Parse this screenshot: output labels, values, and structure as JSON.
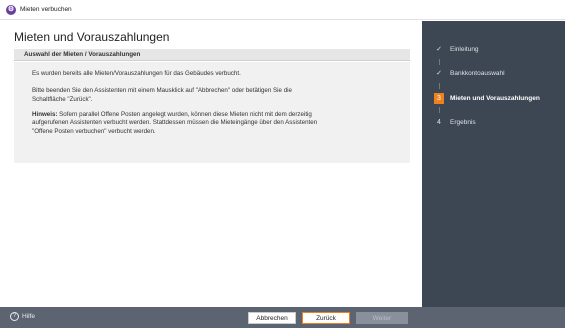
{
  "window": {
    "title": "Mieten verbuchen",
    "icon": "app-logo-icon"
  },
  "page": {
    "title": "Mieten und Vorauszahlungen",
    "section_title": "Auswahl der Mieten / Vorauszahlungen",
    "para1": "Es wurden bereits alle Mieten/Vorauszahlungen für das Gebäudes verbucht.",
    "para2_line1": "Bitte beenden Sie den Assistenten mit einem Mausklick auf \"Abbrechen\" oder betätigen Sie die",
    "para2_line2": "Schaltfläche \"Zurück\".",
    "hint_label": "Hinweis:",
    "hint_line1": " Sofern parallel Offene Posten angelegt wurden, können diese Mieten nicht mit dem derzeitig",
    "hint_line2": "aufgerufenen Assistenten verbucht werden. Stattdessen müssen die Mieteingänge über den Assistenten",
    "hint_line3": "\"Offene Posten verbuchen\" verbucht werden."
  },
  "steps": [
    {
      "label": "Einleitung",
      "state": "done",
      "mark": "✓"
    },
    {
      "label": "Bankkontoauswahl",
      "state": "done",
      "mark": "✓"
    },
    {
      "label": "Mieten und Vorauszahlungen",
      "state": "active",
      "mark": "3"
    },
    {
      "label": "Ergebnis",
      "state": "pending",
      "mark": "4"
    }
  ],
  "footer": {
    "help_label": "Hilfe",
    "cancel_label": "Abbrechen",
    "back_label": "Zurück",
    "next_label": "Weiter"
  },
  "colors": {
    "accent": "#f07f1d",
    "sidebar_bg": "#3d4653",
    "footer_bg": "#5c6371"
  }
}
